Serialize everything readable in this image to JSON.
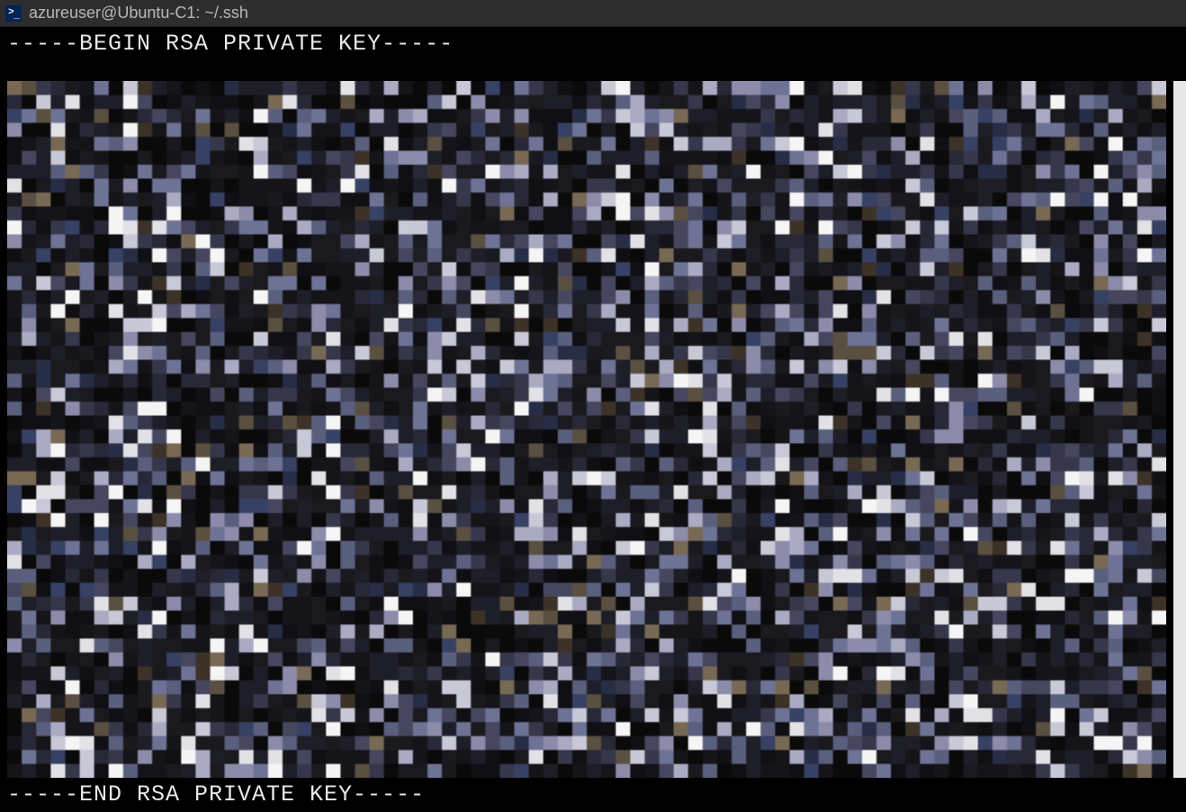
{
  "titlebar": {
    "title": "azureuser@Ubuntu-C1: ~/.ssh"
  },
  "terminal": {
    "begin_line": "-----BEGIN RSA PRIVATE KEY-----",
    "end_line": "-----END RSA PRIVATE KEY-----",
    "body_note": "obscured/pixelated key content (not readable)"
  }
}
